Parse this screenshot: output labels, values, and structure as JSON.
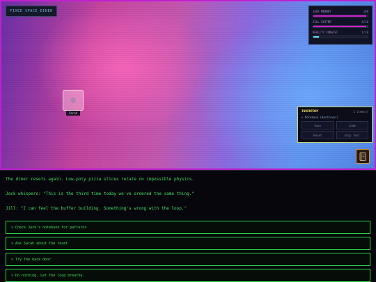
{
  "location": {
    "label": "FIXED SPACE DINER"
  },
  "stats": [
    {
      "label": "JACK MEMORY",
      "value": "100",
      "level": 0.98,
      "color": "#c81fc7"
    },
    {
      "label": "JILL SYSTEM",
      "value": "8/10",
      "level": 0.98,
      "color": "#d21fd0"
    },
    {
      "label": "REALITY CONSIST",
      "value": "1/10",
      "level": 0.1,
      "color": "#55e6f0"
    }
  ],
  "npc": {
    "name": "Sarah"
  },
  "inventory": {
    "title": "INVENTORY",
    "count": "1 item(s)",
    "items": [
      "• Notebook (Hardcover)"
    ],
    "buttons": {
      "save": "Save",
      "load": "Load",
      "reset": "Reset",
      "skip": "Skip Text"
    }
  },
  "notebook_button": {
    "icon": "notebook-icon",
    "glyph": "📓"
  },
  "dialogue": {
    "lines": [
      "The diner resets again. Low-poly pizza slices rotate on impossible physics.",
      "Jack whispers: \"This is the third time today we've ordered the same thing.\"",
      "Jill: \"I can feel the buffer building. Something's wrong with the loop.\""
    ],
    "choices": [
      "> Check Jack's notebook for patterns",
      "> Ask Sarah about the reset",
      "> Try the back door",
      "> Do nothing. Let the loop breathe."
    ]
  }
}
